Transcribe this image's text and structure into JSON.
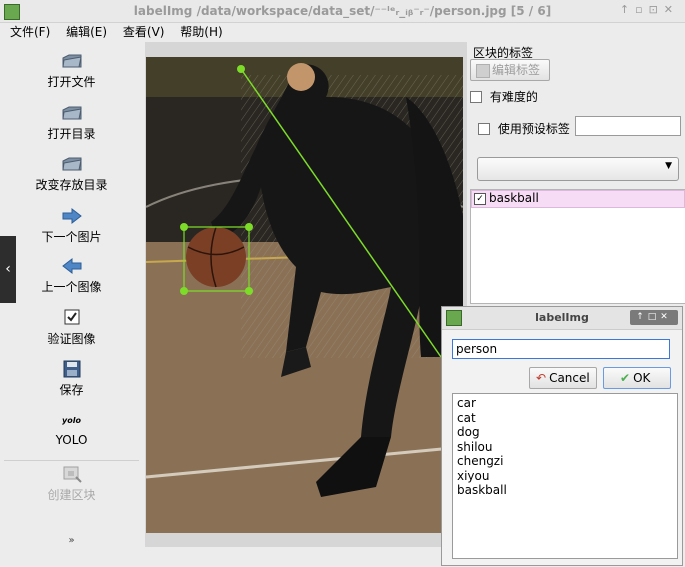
{
  "window": {
    "title": "labelImg /data/workspace/data_set/⁻⁻ˡᵉᵣ_ᵢᵦ⁻ᵣ⁻/person.jpg [5 / 6]"
  },
  "menu": {
    "items": [
      "文件(F)",
      "编辑(E)",
      "查看(V)",
      "帮助(H)"
    ]
  },
  "toolbar": {
    "open_file": "打开文件",
    "open_dir": "打开目录",
    "change_save_dir": "改变存放目录",
    "next_image": "下一个图片",
    "prev_image": "上一个图像",
    "verify_image": "验证图像",
    "save": "保存",
    "yolo_icon_text": "yolo",
    "yolo": "YOLO",
    "create_box": "创建区块"
  },
  "right_panel": {
    "box_labels_title": "区块的标签",
    "edit_label_button": "编辑标签",
    "difficult_label": "有难度的",
    "use_default_label": "使用预设标签",
    "default_label_value": "",
    "labels": [
      {
        "name": "baskball",
        "checked": true
      }
    ]
  },
  "dialog": {
    "title": "labelImg",
    "input_value": "person",
    "cancel_label": "Cancel",
    "ok_label": "OK",
    "options": [
      "car",
      "cat",
      "dog",
      "shilou",
      "chengzi",
      "xiyou",
      "baskball"
    ]
  },
  "colors": {
    "accent": "#3c78d8",
    "box_line": "#7cdc28",
    "selected_label_bg": "#f6dcf4"
  }
}
